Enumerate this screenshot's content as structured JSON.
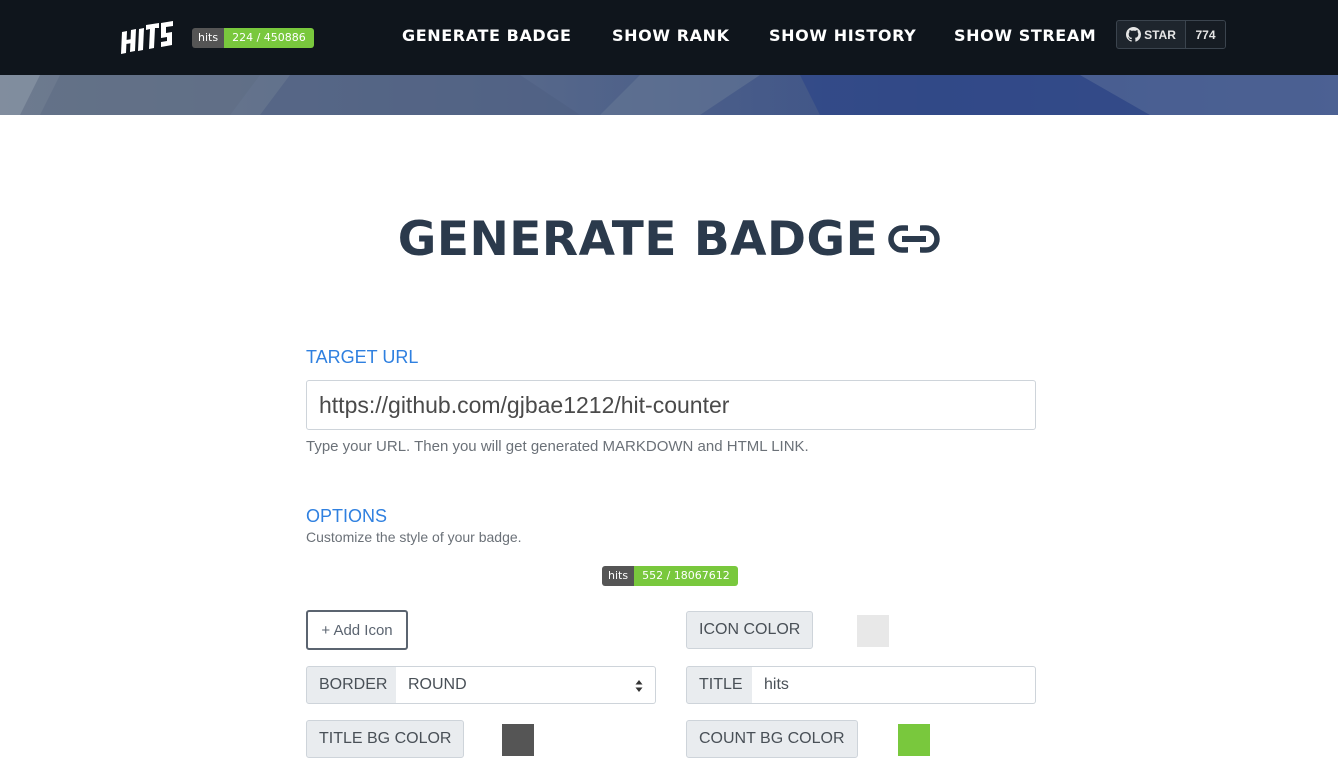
{
  "nav": {
    "logo_text": "HITS",
    "badge": {
      "title": "hits",
      "count": "224 / 450886"
    },
    "links": [
      {
        "label": "GENERATE BADGE"
      },
      {
        "label": "SHOW RANK"
      },
      {
        "label": "SHOW HISTORY"
      },
      {
        "label": "SHOW STREAM"
      }
    ],
    "star": {
      "label": "STAR",
      "count": "774"
    }
  },
  "page": {
    "title": "GENERATE BADGE"
  },
  "target_url": {
    "label": "TARGET URL",
    "value": "https://github.com/gjbae1212/hit-counter",
    "help": "Type your URL. Then you will get generated MARKDOWN and HTML LINK."
  },
  "options": {
    "label": "OPTIONS",
    "subtitle": "Customize the style of your badge.",
    "preview_badge": {
      "title": "hits",
      "count": "552 / 18067612"
    },
    "add_icon_label": "+ Add Icon",
    "icon_color_label": "ICON COLOR",
    "icon_color": "#e8e8e8",
    "border_label": "BORDER",
    "border_value": "ROUND",
    "title_label": "TITLE",
    "title_value": "hits",
    "title_bg_label": "TITLE BG COLOR",
    "title_bg_color": "#555555",
    "count_bg_label": "COUNT BG COLOR",
    "count_bg_color": "#79c83d"
  },
  "colors": {
    "navbar": "#0f151c",
    "accent": "#2f80e0",
    "badge_title_bg": "#555555",
    "badge_count_bg": "#79c83d",
    "heading": "#2b3a4c"
  }
}
